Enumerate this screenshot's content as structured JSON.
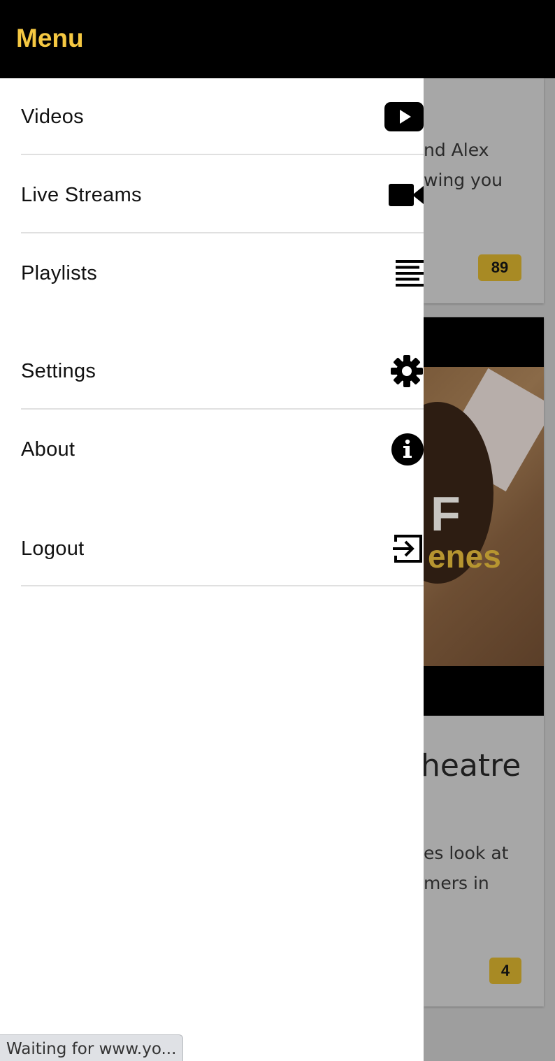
{
  "header": {
    "title": "Menu"
  },
  "menu": {
    "items": [
      {
        "label": "Videos",
        "icon": "video-play-icon"
      },
      {
        "label": "Live Streams",
        "icon": "video-camera-icon"
      },
      {
        "label": "Playlists",
        "icon": "list-lines-icon"
      },
      {
        "label": "Settings",
        "icon": "gear-icon"
      },
      {
        "label": "About",
        "icon": "info-icon"
      },
      {
        "label": "Logout",
        "icon": "logout-icon"
      }
    ]
  },
  "background": {
    "card1": {
      "line1": "nd Alex",
      "line2": "wing you",
      "badge": "89"
    },
    "thumb": {
      "text1": "F",
      "text2": "enes"
    },
    "card2": {
      "title": "heatre",
      "line1": "es look at",
      "line2": "mers in",
      "badge": "4"
    }
  },
  "status": {
    "text": "Waiting for www.yo..."
  },
  "colors": {
    "accent": "#f5c842",
    "badge": "#a88a24",
    "header_bg": "#000000"
  }
}
